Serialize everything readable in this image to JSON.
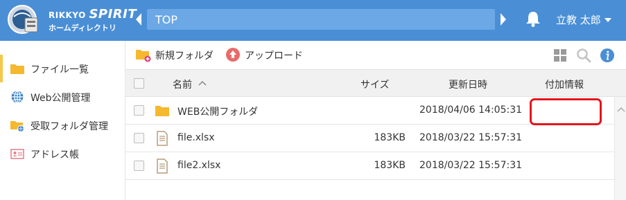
{
  "header": {
    "brand_line1": "RIKKYO",
    "brand_line1_big": "SPIRIT",
    "brand_line2": "ホームディレクトリ",
    "path": "TOP",
    "user_name": "立教 太郎"
  },
  "sidebar": {
    "items": [
      {
        "label": "ファイル一覧",
        "icon": "folder-icon",
        "active": true
      },
      {
        "label": "Web公開管理",
        "icon": "globe-icon",
        "active": false
      },
      {
        "label": "受取フォルダ管理",
        "icon": "shared-folder-icon",
        "active": false
      },
      {
        "label": "アドレス帳",
        "icon": "address-book-icon",
        "active": false
      }
    ]
  },
  "toolbar": {
    "new_folder_label": "新規フォルダ",
    "upload_label": "アップロード"
  },
  "table": {
    "columns": {
      "name": "名前",
      "size": "サイズ",
      "modified": "更新日時",
      "info": "付加情報"
    },
    "sort": "name-ascending",
    "rows": [
      {
        "type": "folder",
        "name": "WEB公開フォルダ",
        "size": "",
        "modified": "2018/04/06 14:05:31",
        "info": ""
      },
      {
        "type": "file",
        "name": "file.xlsx",
        "size": "183KB",
        "modified": "2018/03/22 15:57:31",
        "info": ""
      },
      {
        "type": "file",
        "name": "file2.xlsx",
        "size": "183KB",
        "modified": "2018/03/22 15:57:31",
        "info": ""
      }
    ]
  },
  "colors": {
    "header_bg": "#4a8fd6",
    "pathbar_bg": "#6ba8e5",
    "active_bar": "#f2c94c",
    "folder": "#f5b82e",
    "upload": "#e96b6b",
    "info_icon": "#4a8fd6",
    "highlight": "#e5141b"
  }
}
